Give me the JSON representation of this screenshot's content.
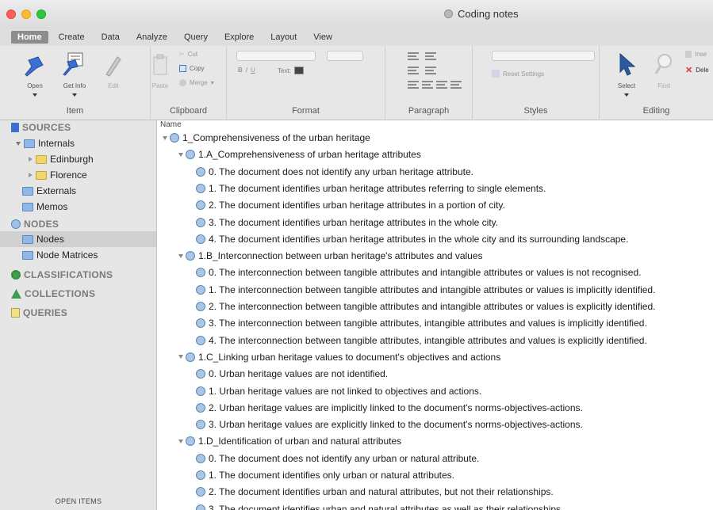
{
  "window": {
    "title": "Coding notes"
  },
  "ribbon": {
    "tabs": [
      "Home",
      "Create",
      "Data",
      "Analyze",
      "Query",
      "Explore",
      "Layout",
      "View"
    ],
    "active_tab": "Home",
    "item_group": {
      "label": "Item",
      "buttons": [
        "Open",
        "Get Info",
        "Edit"
      ]
    },
    "clipboard_group": {
      "label": "Clipboard",
      "paste": "Paste",
      "cut": "Cut",
      "copy": "Copy",
      "merge": "Merge"
    },
    "format_group": {
      "label": "Format",
      "text_label": "Text:",
      "style_buttons": [
        "B",
        "I",
        "U"
      ]
    },
    "paragraph_group": {
      "label": "Paragraph"
    },
    "styles_group": {
      "label": "Styles",
      "reset": "Reset Settings"
    },
    "editing_group": {
      "label": "Editing",
      "select": "Select",
      "find": "Find",
      "insert": "Inse",
      "delete": "Dele"
    }
  },
  "sidebar": {
    "sources_header": "SOURCES",
    "internals": "Internals",
    "edinburgh": "Edinburgh",
    "florence": "Florence",
    "externals": "Externals",
    "memos": "Memos",
    "nodes_header": "NODES",
    "nodes": "Nodes",
    "node_matrices": "Node Matrices",
    "classifications": "CLASSIFICATIONS",
    "collections": "COLLECTIONS",
    "queries": "QUERIES",
    "open_items": "OPEN ITEMS"
  },
  "main": {
    "column_header": "Name",
    "rows": [
      {
        "level": 0,
        "expanded": true,
        "text": "1_Comprehensiveness of the urban heritage"
      },
      {
        "level": 1,
        "expanded": true,
        "text": "1.A_Comprehensiveness of urban heritage attributes"
      },
      {
        "level": 2,
        "text": "0. The document does not identify any urban heritage attribute."
      },
      {
        "level": 2,
        "text": "1. The document identifies urban heritage attributes referring to single elements."
      },
      {
        "level": 2,
        "text": "2. The document identifies urban heritage attributes in a portion of city."
      },
      {
        "level": 2,
        "text": "3. The document identifies urban heritage attributes in the whole city."
      },
      {
        "level": 2,
        "text": "4. The document identifies urban heritage attributes in the whole city and its surrounding landscape."
      },
      {
        "level": 1,
        "expanded": true,
        "text": "1.B_Interconnection between urban heritage's attributes and values"
      },
      {
        "level": 2,
        "text": "0. The interconnection between tangible attributes and intangible attributes or values is not recognised."
      },
      {
        "level": 2,
        "text": "1. The interconnection between tangible attributes and intangible attributes or values is implicitly identified."
      },
      {
        "level": 2,
        "text": "2. The interconnection between tangible attributes and intangible attributes or values is explicitly identified."
      },
      {
        "level": 2,
        "text": "3. The interconnection between tangible attributes, intangible attributes and values is implicitly identified."
      },
      {
        "level": 2,
        "text": "4. The interconnection between tangible attributes, intangible attributes and values is explicitly identified."
      },
      {
        "level": 1,
        "expanded": true,
        "text": "1.C_Linking urban heritage values to document's objectives and actions"
      },
      {
        "level": 2,
        "text": "0. Urban heritage values are not identified."
      },
      {
        "level": 2,
        "text": "1. Urban heritage values are not linked to objectives and actions."
      },
      {
        "level": 2,
        "text": "2. Urban heritage values are implicitly linked to the document's norms-objectives-actions."
      },
      {
        "level": 2,
        "text": "3. Urban heritage values are explicitly linked to the document's norms-objectives-actions."
      },
      {
        "level": 1,
        "expanded": true,
        "text": "1.D_Identification of urban and natural attributes"
      },
      {
        "level": 2,
        "text": "0. The document does not identify any urban or natural attribute."
      },
      {
        "level": 2,
        "text": "1. The document identifies only urban or natural attributes."
      },
      {
        "level": 2,
        "text": "2. The document identifies urban and natural attributes, but not their relationships."
      },
      {
        "level": 2,
        "text": "3. The document identifies urban and natural attributes as well as their relationships."
      }
    ]
  }
}
